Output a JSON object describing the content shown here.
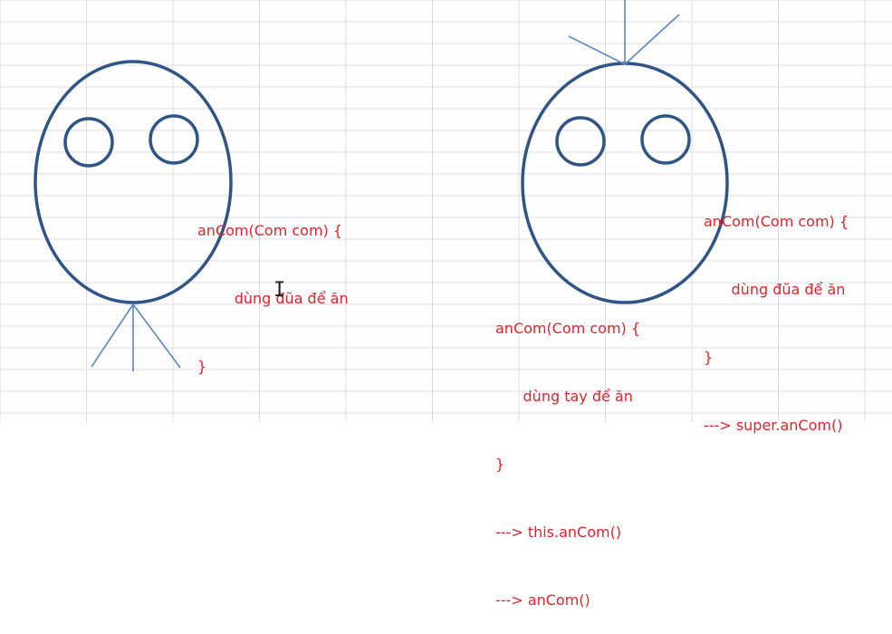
{
  "colors": {
    "outline": "#2e5488",
    "lines": "#5b87c5",
    "code_text": "#e8202a",
    "grid": "#dcdcdc"
  },
  "left_figure": {
    "code_lines": [
      "anCom(Com com) {",
      "        dùng đũa để ăn",
      "}"
    ]
  },
  "right_figure": {
    "parent_code_lines": [
      "anCom(Com com) {",
      "      dùng đũa để ăn",
      "}",
      "---> super.anCom()"
    ],
    "child_code_lines": [
      "anCom(Com com) {",
      "      dùng tay để ăn",
      "}",
      "---> this.anCom()",
      "---> anCom()"
    ]
  },
  "cursor_icon": "text-cursor-icon"
}
